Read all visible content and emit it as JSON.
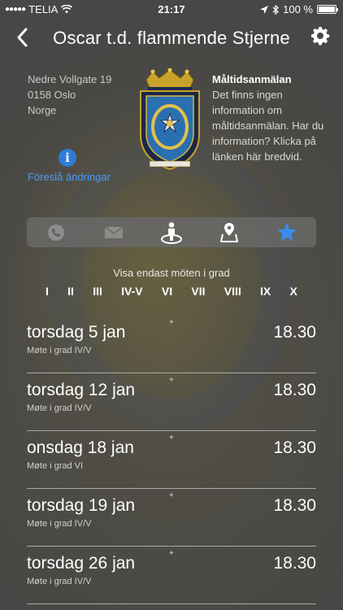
{
  "status_bar": {
    "carrier": "TELIA",
    "time": "21:17",
    "battery": "100 %"
  },
  "nav": {
    "title": "Oscar t.d. flammende Stjerne"
  },
  "address": {
    "street": "Nedre Vollgate 19",
    "city": "0158 Oslo",
    "country": "Norge"
  },
  "suggest_changes": "Föreslå ändringar",
  "meal": {
    "heading": "Måltidsanmälan",
    "text": "Det finns ingen information om måltidsanmälan. Har du information? Klicka på länken här bredvid."
  },
  "tabs": [
    {
      "icon": "phone-icon"
    },
    {
      "icon": "mail-icon"
    },
    {
      "icon": "person-location-icon"
    },
    {
      "icon": "map-pin-icon"
    },
    {
      "icon": "star-icon",
      "active": true
    }
  ],
  "grade_filter": {
    "label": "Visa endast möten i grad",
    "grades": [
      "I",
      "II",
      "III",
      "IV-V",
      "VI",
      "VII",
      "VIII",
      "IX",
      "X"
    ]
  },
  "meetings": [
    {
      "date": "torsdag 5 jan",
      "subtitle": "Møte i grad IV/V",
      "time": "18.30"
    },
    {
      "date": "torsdag 12 jan",
      "subtitle": "Møte i grad IV/V",
      "time": "18.30"
    },
    {
      "date": "onsdag 18 jan",
      "subtitle": "Møte i grad VI",
      "time": "18.30"
    },
    {
      "date": "torsdag 19 jan",
      "subtitle": "Møte i grad IV/V",
      "time": "18.30"
    },
    {
      "date": "torsdag 26 jan",
      "subtitle": "Møte i grad IV/V",
      "time": "18.30"
    }
  ],
  "colors": {
    "accent_blue": "#2f7cd8",
    "link_blue": "#4b9bf5",
    "active_tab": "#3a8df0"
  }
}
